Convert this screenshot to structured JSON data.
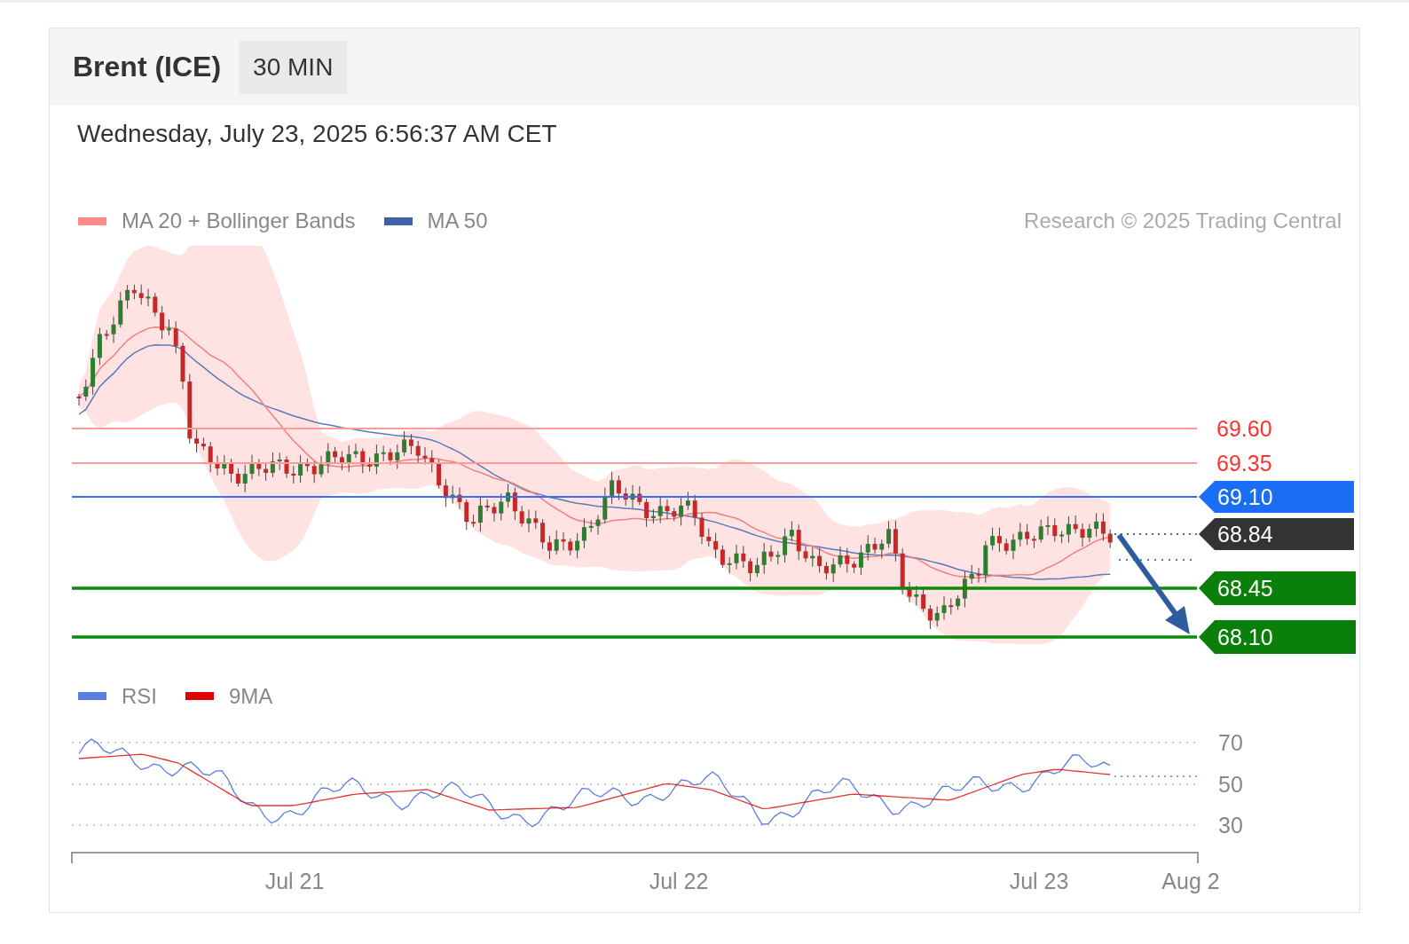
{
  "header": {
    "title": "Brent (ICE)",
    "interval": "30 MIN"
  },
  "timestamp": "Wednesday, July 23, 2025 6:56:37 AM CET",
  "legend": [
    {
      "label": "MA 20 + Bollinger Bands",
      "color": "#ff8a8a"
    },
    {
      "label": "MA 50",
      "color": "#3d62a8"
    }
  ],
  "credit": "Research © 2025 Trading Central",
  "levels": [
    {
      "label": "69.60",
      "kind": "resistance"
    },
    {
      "label": "69.35",
      "kind": "resistance"
    },
    {
      "label": "69.10",
      "kind": "pivot"
    },
    {
      "label": "68.84",
      "kind": "last"
    },
    {
      "label": "68.45",
      "kind": "support"
    },
    {
      "label": "68.10",
      "kind": "support"
    }
  ],
  "rsi_legend": [
    {
      "label": "RSI",
      "color": "#5b7fe0"
    },
    {
      "label": "9MA",
      "color": "#e00000"
    }
  ],
  "rsi_ticks": [
    "70",
    "50",
    "30"
  ],
  "x_labels": [
    "Jul 21",
    "Jul 22",
    "Jul 23",
    "Aug 2"
  ]
}
